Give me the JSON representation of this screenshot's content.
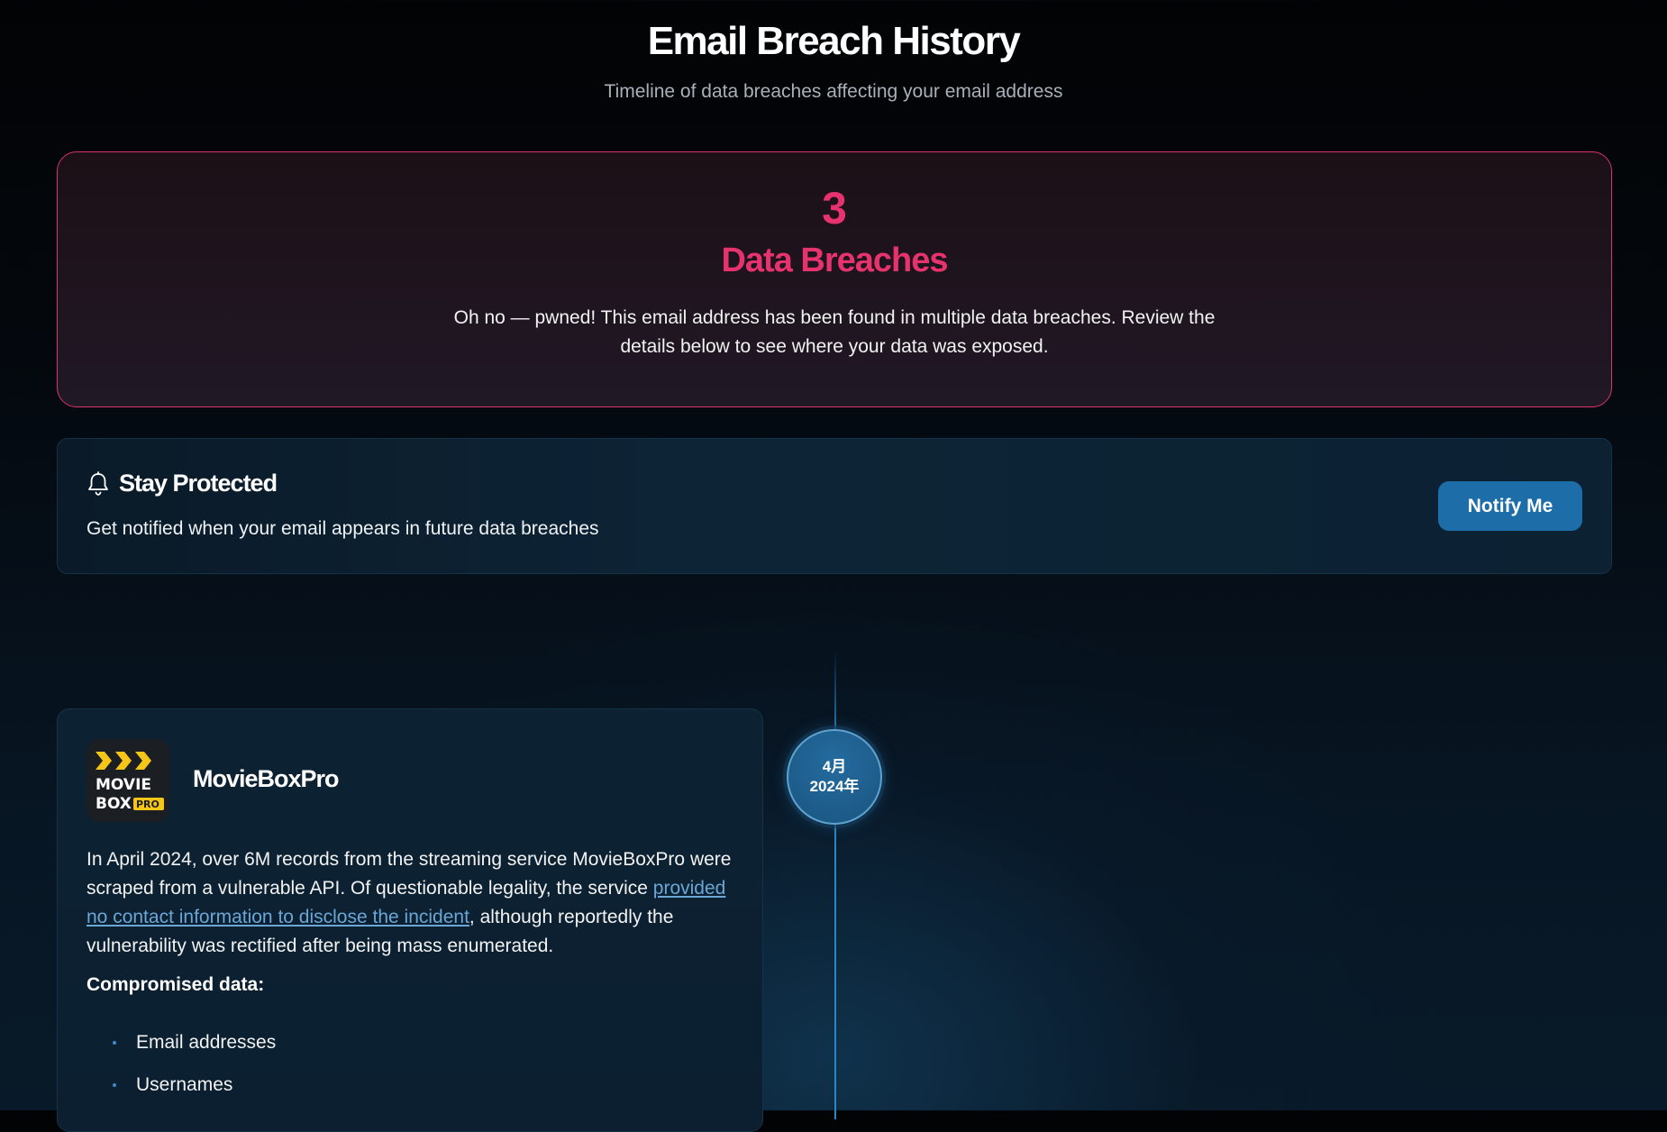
{
  "header": {
    "title": "Email Breach History",
    "subtitle": "Timeline of data breaches affecting your email address"
  },
  "summary": {
    "count": "3",
    "label": "Data Breaches",
    "message": "Oh no — pwned! This email address has been found in multiple data breaches. Review the details below to see where your data was exposed."
  },
  "protect": {
    "icon": "bell-icon",
    "title": "Stay Protected",
    "description": "Get notified when your email appears in future data breaches",
    "button_label": "Notify Me"
  },
  "timeline": {
    "entries": [
      {
        "date_month": "4月",
        "date_year": "2024年",
        "name": "MovieBoxPro",
        "logo": {
          "line1": "MOVIE",
          "line2": "BOX",
          "badge": "PRO"
        },
        "description_before": "In April 2024, over 6M records from the streaming service MovieBoxPro were scraped from a vulnerable API. Of questionable legality, the service ",
        "description_link": "provided no contact information to disclose the incident",
        "description_after": ", although reportedly the vulnerability was rectified after being mass enumerated.",
        "compromised_label": "Compromised data:",
        "compromised_data": [
          "Email addresses",
          "Usernames"
        ]
      }
    ]
  },
  "colors": {
    "accent_pink": "#e6326d",
    "button_blue": "#1d6ea8",
    "link_blue": "#6aa7d6"
  }
}
